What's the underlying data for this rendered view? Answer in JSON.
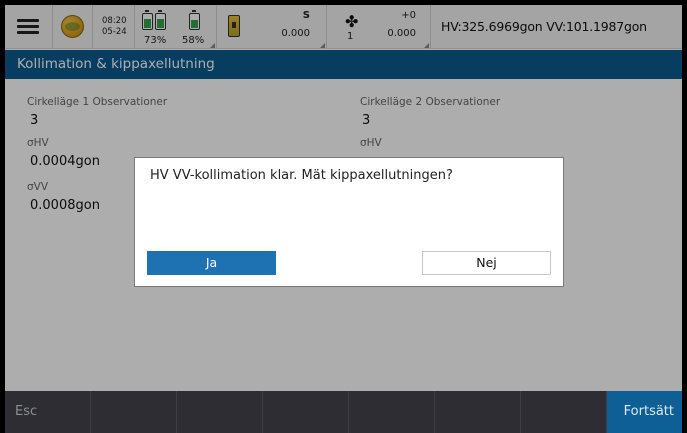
{
  "status": {
    "time": "08:20",
    "date": "05-24",
    "battery1_pct": "73%",
    "battery1_level": 0.73,
    "battery2_pct": "58%",
    "battery2_level": 0.58,
    "instrument_mode": "S",
    "instrument_value": "0.000",
    "prism_number": "1",
    "prism_constant": "+0",
    "prism_value": "0.000",
    "angles": "HV:325.6969gon VV:101.1987gon"
  },
  "title": "Kollimation & kippaxellutning",
  "face1": {
    "header": "Cirkelläge 1 Observationer",
    "count": "3",
    "sigma_hv_label": "σHV",
    "sigma_hv": "0.0004gon",
    "sigma_vv_label": "σVV",
    "sigma_vv": "0.0008gon"
  },
  "face2": {
    "header": "Cirkelläge 2 Observationer",
    "count": "3",
    "sigma_hv_label": "σHV"
  },
  "dialog": {
    "message": "HV VV-kollimation klar. Mät kippaxellutningen?",
    "yes_label": "Ja",
    "no_label": "Nej"
  },
  "bottom": {
    "esc_label": "Esc",
    "continue_label": "Fortsätt"
  },
  "colors": {
    "title_bar": "#0b5b8f",
    "primary_button": "#1f72b2",
    "bottom_bar": "#2d2d33",
    "continue_button": "#0e5f96"
  },
  "icons": [
    "menu-icon",
    "globe-icon",
    "battery-icon",
    "instrument-icon",
    "prism-icon"
  ]
}
